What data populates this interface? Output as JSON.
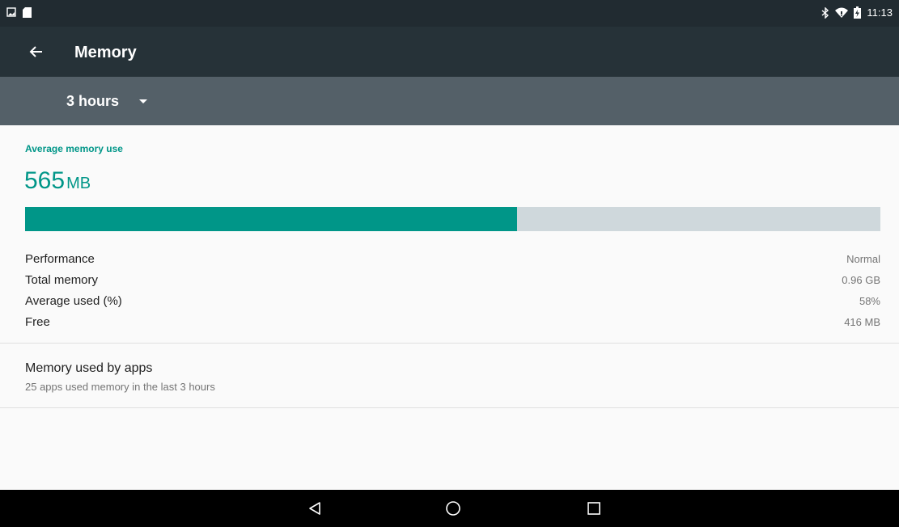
{
  "status_bar": {
    "time": "11:13"
  },
  "app_bar": {
    "title": "Memory"
  },
  "spinner": {
    "selected": "3 hours"
  },
  "average": {
    "label": "Average memory use",
    "value": "565",
    "unit": "MB",
    "used_fraction": 0.575
  },
  "stats": [
    {
      "label": "Performance",
      "value": "Normal"
    },
    {
      "label": "Total memory",
      "value": "0.96 GB"
    },
    {
      "label": "Average used (%)",
      "value": "58%"
    },
    {
      "label": "Free",
      "value": "416 MB"
    }
  ],
  "apps": {
    "title": "Memory used by apps",
    "subtitle": "25 apps used memory in the last 3 hours"
  },
  "colors": {
    "accent": "#009688",
    "app_bar": "#263238",
    "status_bar": "#212b31",
    "spinner_bar": "#546068",
    "bar_track": "#cfd8dc"
  },
  "icons": {
    "status_left": [
      "image-notification-icon",
      "sd-card-icon"
    ],
    "status_right": [
      "bluetooth-icon",
      "wifi-icon",
      "battery-charging-icon"
    ],
    "nav": [
      "back-icon",
      "home-icon",
      "recents-icon"
    ]
  }
}
